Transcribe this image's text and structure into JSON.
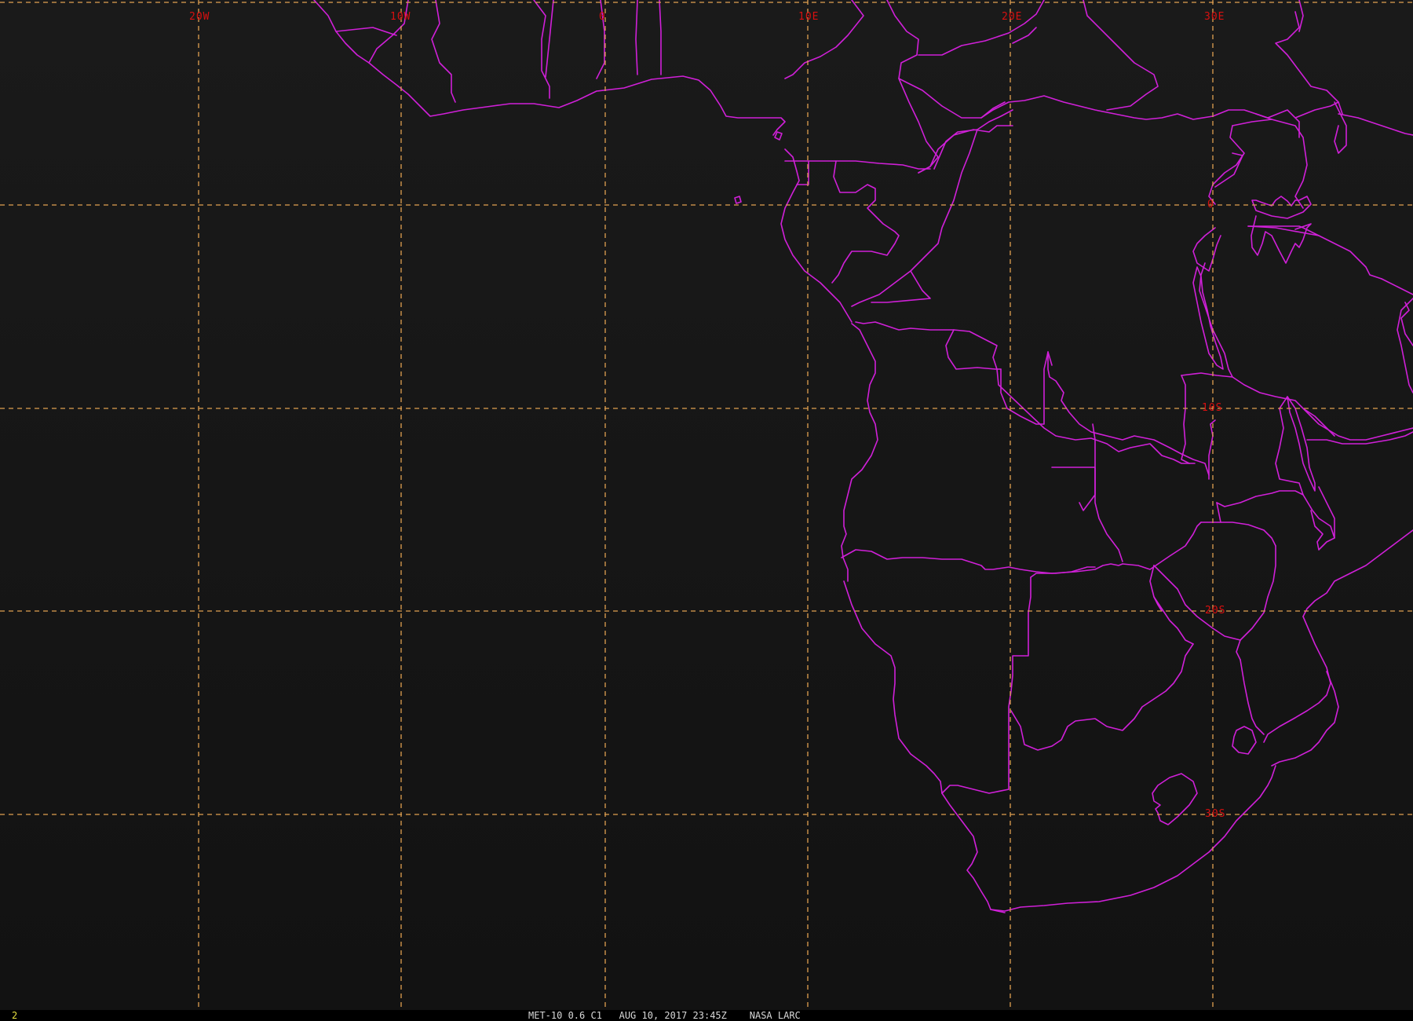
{
  "image": {
    "frame_number": "2",
    "caption": "MET-10 0.6 C1   AUG 10, 2017 23:45Z    NASA LARC",
    "background_color": "#151515",
    "grid_color": "#e0a050",
    "label_color": "#d81010",
    "border_color": "#d020d8"
  },
  "grid": {
    "longitude_labels": [
      "20W",
      "10W",
      "0",
      "10E",
      "20E",
      "30E"
    ],
    "latitude_labels": [
      "0",
      "10S",
      "20S",
      "30S"
    ]
  }
}
